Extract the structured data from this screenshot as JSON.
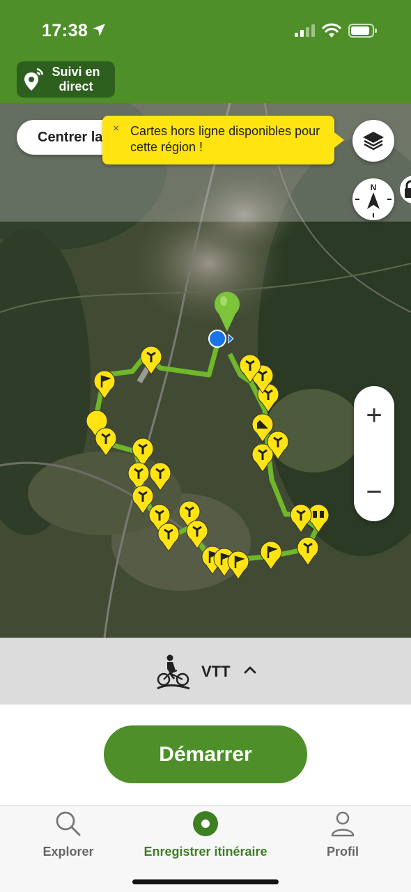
{
  "status_bar": {
    "time": "17:38"
  },
  "header": {
    "live_tracking_label": "Suivi en direct"
  },
  "map": {
    "center_button_label": "Centrer la",
    "offline_tooltip": "Cartes hors ligne disponibles pour cette région !",
    "tooltip_close": "×",
    "compass_label": "N",
    "zoom_in": "+",
    "zoom_out": "−",
    "route_color": "#6fb82a",
    "marker_color": "#ffe411"
  },
  "activity": {
    "label": "VTT"
  },
  "start_button": {
    "label": "Démarrer"
  },
  "tabs": [
    {
      "label": "Explorer",
      "icon": "search-icon",
      "active": false
    },
    {
      "label": "Enregistrer itinéraire",
      "icon": "record-icon",
      "active": true
    },
    {
      "label": "Profil",
      "icon": "person-icon",
      "active": false
    }
  ],
  "colors": {
    "brand_green": "#4e8f29",
    "dark_green": "#2d5f1e",
    "tooltip_yellow": "#ffe411"
  }
}
